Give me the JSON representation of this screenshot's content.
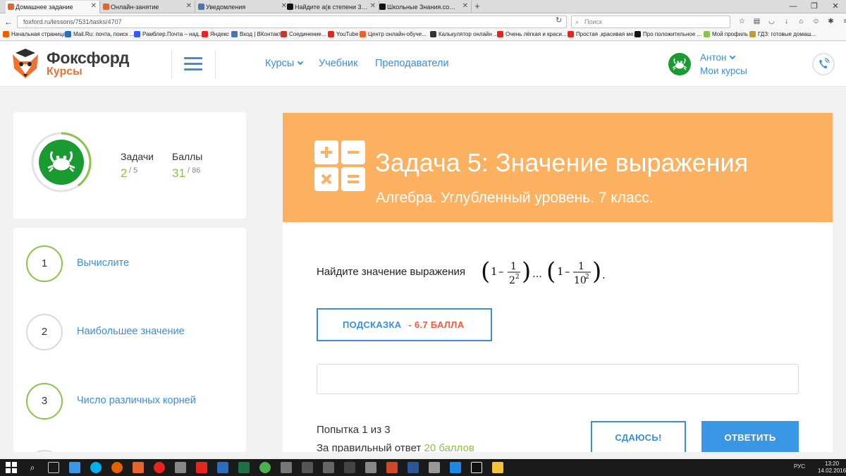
{
  "browser": {
    "tabs": [
      {
        "title": "Домашнее задание",
        "active": true,
        "color": "#e8632b"
      },
      {
        "title": "Онлайн-занятие",
        "active": false,
        "color": "#e8632b"
      },
      {
        "title": "Уведомления",
        "active": false,
        "color": "#4a76a8"
      },
      {
        "title": "Найдите a(в степени 3)+...",
        "active": false,
        "color": "#111111"
      },
      {
        "title": "Школьные Знания.com -...",
        "active": false,
        "color": "#111111"
      }
    ],
    "new_tab": "+",
    "url": "foxford.ru/lessons/7531/tasks/4707",
    "search_placeholder": "Поиск",
    "bookmarks": [
      {
        "label": "Начальная страница",
        "color": "#e66000"
      },
      {
        "label": "Mail.Ru: почта, поиск ...",
        "color": "#2b6ebf"
      },
      {
        "label": "Рамблер.Почта – над...",
        "color": "#315efb"
      },
      {
        "label": "Яндекс",
        "color": "#e52620"
      },
      {
        "label": "Вход | ВКонтакте",
        "color": "#4a76a8"
      },
      {
        "label": "Соединение...",
        "color": "#c0392b"
      },
      {
        "label": "YouTube",
        "color": "#e52620"
      },
      {
        "label": "Центр онлайн-обуче...",
        "color": "#e8632b"
      },
      {
        "label": "Калькулятор онлайн ...",
        "color": "#333333"
      },
      {
        "label": "Очень лёгкая и краси...",
        "color": "#e52620"
      },
      {
        "label": "Простая ,красивая ме...",
        "color": "#e52620"
      },
      {
        "label": "Про положительное ...",
        "color": "#111111"
      },
      {
        "label": "Мой профиль",
        "color": "#8bc34a"
      },
      {
        "label": "ГДЗ: готовые домаш...",
        "color": "#c59b3a"
      }
    ]
  },
  "header": {
    "logo_title": "Фоксфорд",
    "logo_sub": "Курсы",
    "nav": [
      {
        "label": "Курсы",
        "has_dropdown": true
      },
      {
        "label": "Учебник",
        "has_dropdown": false
      },
      {
        "label": "Преподаватели",
        "has_dropdown": false
      }
    ],
    "user_name": "Антон",
    "user_courses": "Мои курсы"
  },
  "stats": {
    "tasks_label": "Задачи",
    "tasks_done": "2",
    "tasks_total": "/ 5",
    "points_label": "Баллы",
    "points_done": "31",
    "points_total": "/ 86",
    "progress": 0.4
  },
  "task_list": [
    {
      "num": "1",
      "label": "Вычислите",
      "state": "done"
    },
    {
      "num": "2",
      "label": "Наибольшее значение",
      "state": "pending"
    },
    {
      "num": "3",
      "label": "Число различных корней",
      "state": "done"
    }
  ],
  "task": {
    "title": "Задача 5: Значение выражения",
    "subtitle": "Алгебра. Углубленный уровень. 7 класс.",
    "problem_text": "Найдите значение выражения",
    "formula": {
      "first_factor": {
        "one": "1",
        "minus": "–",
        "numerator": "1",
        "denominator_base": "2",
        "denominator_exp": "2"
      },
      "ellipsis": "…",
      "last_factor": {
        "one": "1",
        "minus": "–",
        "numerator": "1",
        "denominator_base": "10",
        "denominator_exp": "2"
      },
      "end": "."
    },
    "hint_label": "ПОДСКАЗКА",
    "hint_cost": "- 6.7 БАЛЛА",
    "answer_value": "",
    "attempt_text": "Попытка 1 из 3",
    "reward_prefix": "За правильный ответ",
    "reward_points": "20 баллов",
    "giveup_label": "СДАЮСЬ!",
    "submit_label": "ОТВЕТИТЬ"
  },
  "taskbar": {
    "lang": "РУС",
    "time": "13:20",
    "date": "14.02.2016"
  },
  "colors": {
    "accent": "#3a8fd8",
    "banner": "#fbb15f",
    "success": "#8bc34a",
    "danger": "#f15a3c",
    "brand_orange": "#f26f2e"
  }
}
